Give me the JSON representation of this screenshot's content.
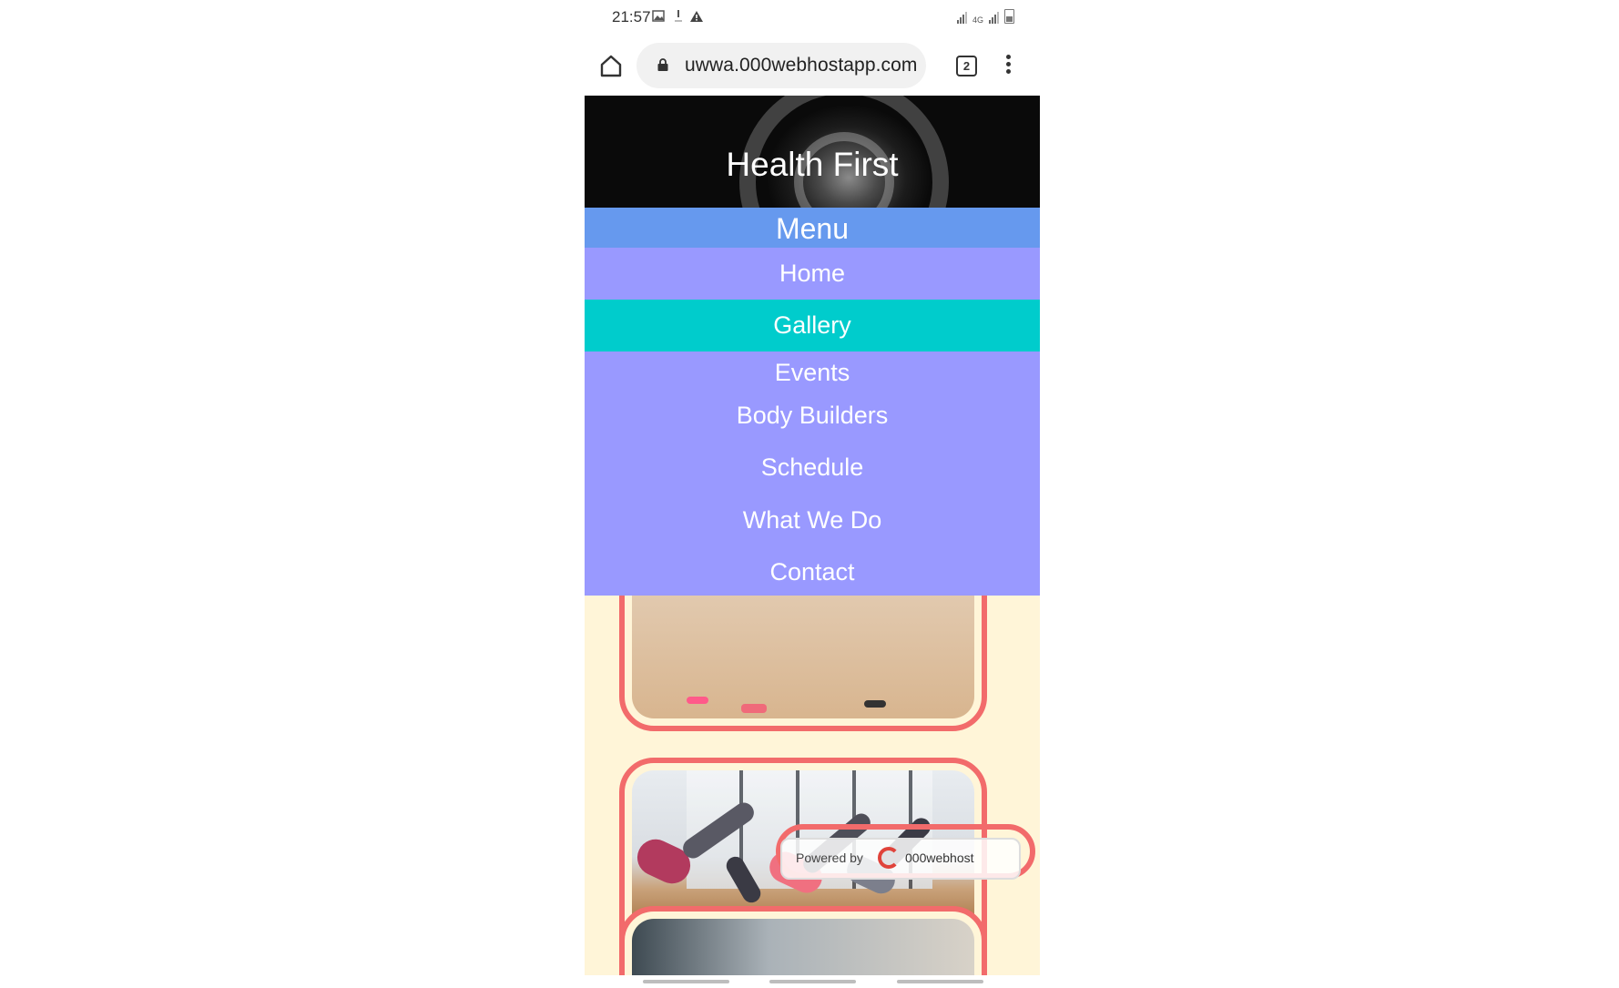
{
  "status_bar": {
    "time": "21:57",
    "network": "4G"
  },
  "browser": {
    "url": "uwwa.000webhostapp.com",
    "tab_count": "2",
    "icons": [
      "home-icon",
      "lock-icon",
      "tabs-icon",
      "more-icon"
    ]
  },
  "site": {
    "title": "Health  First",
    "menu_label": "Menu",
    "menu_items": [
      {
        "label": "Home",
        "active": false
      },
      {
        "label": "Gallery",
        "active": true
      },
      {
        "label": "Events",
        "active": false
      },
      {
        "label": "Body Builders",
        "active": false
      },
      {
        "label": "Schedule",
        "active": false
      },
      {
        "label": "What We Do",
        "active": false
      },
      {
        "label": "Contact",
        "active": false
      }
    ]
  },
  "badge": {
    "powered_by": "Powered by",
    "brand": "000webhost"
  },
  "colors": {
    "menu_header": "#6699ee",
    "menu_item": "#9999ff",
    "menu_active": "#00cccc",
    "page_bg": "#fff5d8",
    "frame_border": "#f26b6b"
  }
}
